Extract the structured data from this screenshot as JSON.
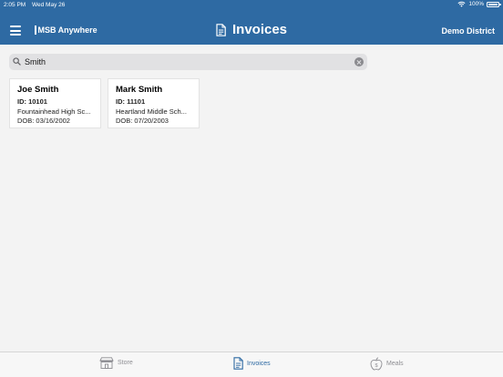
{
  "status": {
    "time": "2:05 PM",
    "date": "Wed May 26",
    "battery": "100%"
  },
  "header": {
    "brand": "MSB Anywhere",
    "title": "Invoices",
    "district": "Demo District"
  },
  "search": {
    "value": "Smith",
    "placeholder": "Search"
  },
  "students": [
    {
      "name": "Joe Smith",
      "id": "ID: 10101",
      "school": "Fountainhead High Sc...",
      "dob": "DOB: 03/16/2002"
    },
    {
      "name": "Mark Smith",
      "id": "ID: 11101",
      "school": "Heartland Middle Sch...",
      "dob": "DOB: 07/20/2003"
    }
  ],
  "tabs": [
    {
      "label": "Store",
      "icon": "store-icon",
      "active": false
    },
    {
      "label": "Invoices",
      "icon": "document-icon",
      "active": true
    },
    {
      "label": "Meals",
      "icon": "apple-icon",
      "active": false
    }
  ],
  "colors": {
    "header": "#2e6aa3",
    "background": "#f3f3f3",
    "active_tab": "#2e6aa3",
    "inactive_tab": "#8e8e93"
  }
}
